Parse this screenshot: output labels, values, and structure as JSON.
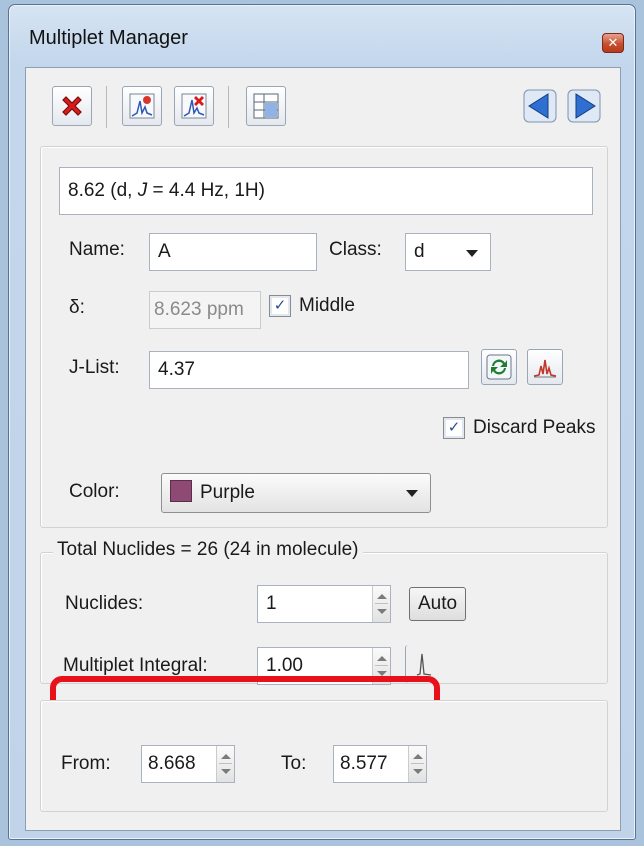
{
  "window": {
    "title": "Multiplet Manager"
  },
  "toolbar": {
    "buttons": [
      {
        "name": "delete-multiplet-button",
        "icon": "red-x-icon"
      },
      {
        "name": "add-peak-button",
        "icon": "peak-add-icon"
      },
      {
        "name": "remove-peak-button",
        "icon": "peak-remove-icon"
      },
      {
        "name": "table-button",
        "icon": "table-icon"
      },
      {
        "name": "previous-button",
        "icon": "arrow-left-icon"
      },
      {
        "name": "next-button",
        "icon": "arrow-right-icon"
      }
    ]
  },
  "multiplet": {
    "summary_prefix": "8.62 (d, ",
    "summary_j": "J",
    "summary_suffix": " = 4.4 Hz, 1H)",
    "name_label": "Name:",
    "name_value": "A",
    "class_label": "Class:",
    "class_value": "d",
    "delta_label": "δ:",
    "delta_value": "8.623 ppm",
    "middle_label": "Middle",
    "middle_checked": true,
    "jlist_label": "J-List:",
    "jlist_value": "4.37",
    "discard_label": "Discard Peaks",
    "discard_checked": true,
    "color_label": "Color:",
    "color_value": "Purple",
    "color_swatch": "#8e4a73"
  },
  "nuclides": {
    "group_title": "Total Nuclides = 26 (24 in molecule)",
    "nuclides_label": "Nuclides:",
    "nuclides_value": "1",
    "auto_label": "Auto",
    "integral_label": "Multiplet Integral:",
    "integral_value": "1.00"
  },
  "range": {
    "from_label": "From:",
    "from_value": "8.668",
    "to_label": "To:",
    "to_value": "8.577"
  },
  "colors": {
    "highlight": "#e8111b",
    "accent": "#2f6fd1"
  }
}
